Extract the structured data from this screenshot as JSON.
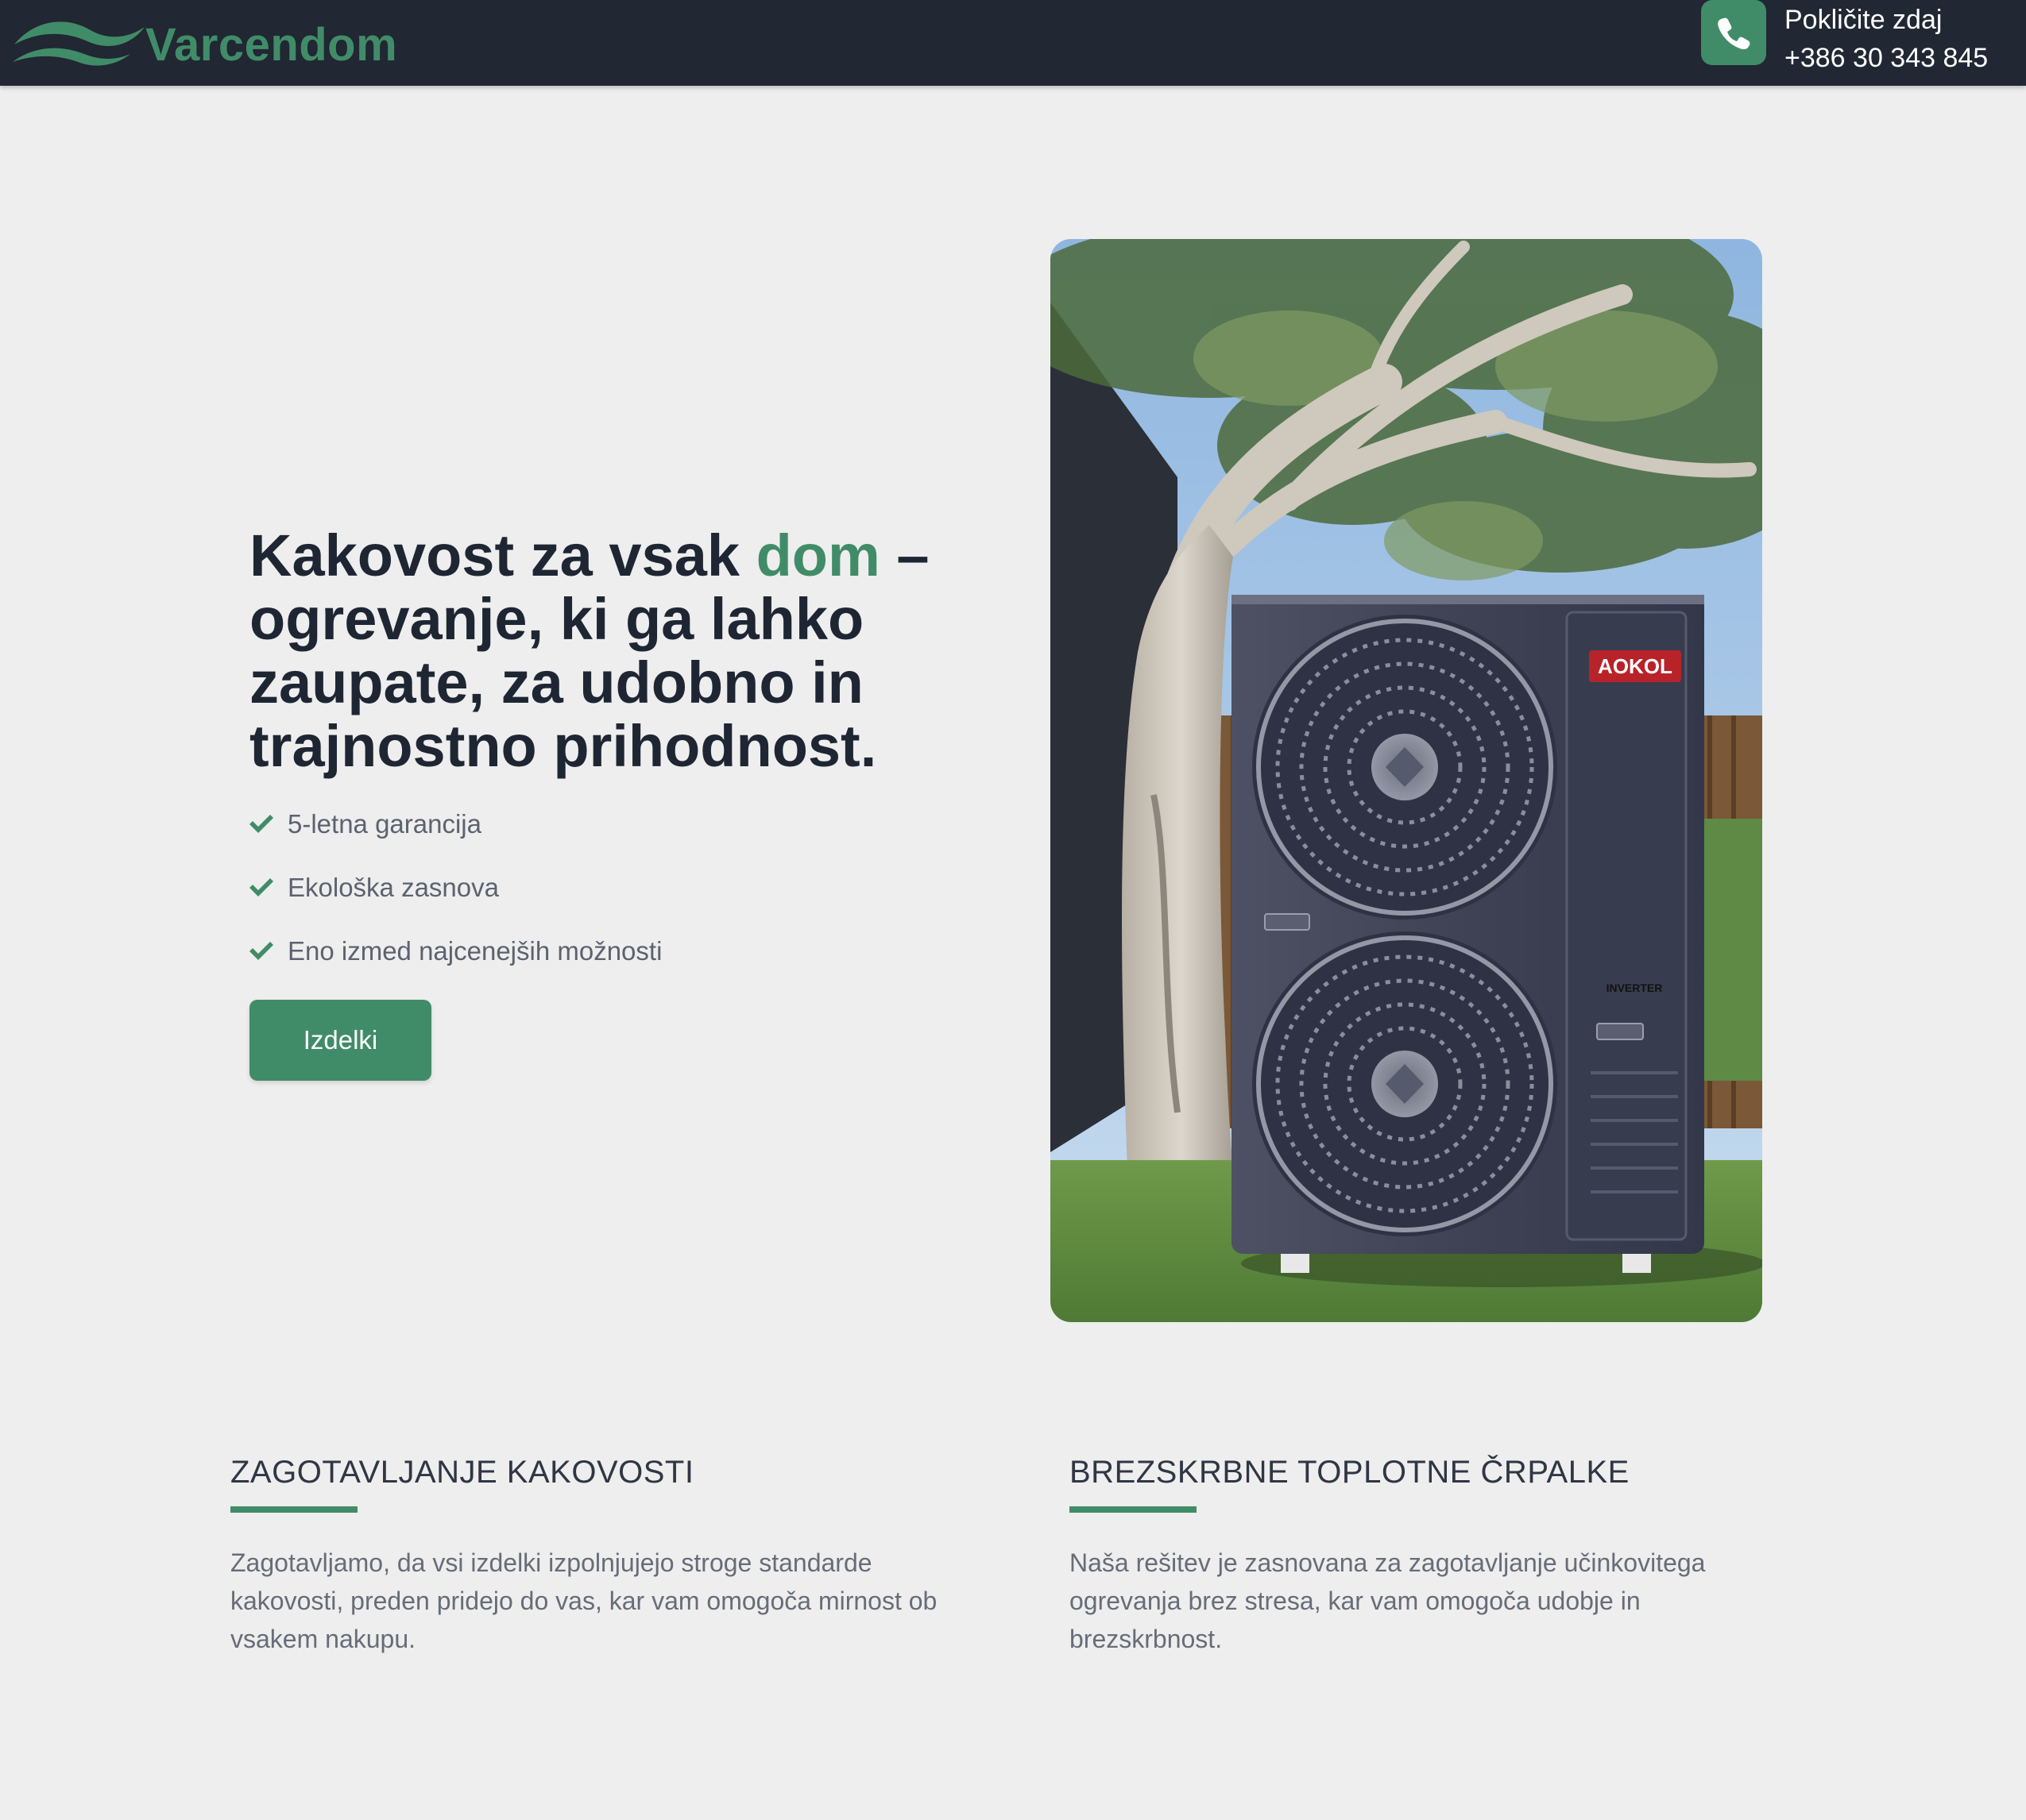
{
  "header": {
    "brand": "Varcendom",
    "call_label": "Pokličite zdaj",
    "call_number": "+386 30 343 845",
    "accent_color": "#418c68",
    "background_color": "#212733",
    "phone_icon": "phone-icon"
  },
  "hero": {
    "title_before": "Kakovost za vsak ",
    "title_accent": "dom",
    "title_after": " – ogrevanje, ki ga lahko zaupate, za udobno in trajnostno prihodnost.",
    "features": [
      {
        "text": "5-letna garancija",
        "icon": "check-icon"
      },
      {
        "text": "Ekološka zasnova",
        "icon": "check-icon"
      },
      {
        "text": "Eno izmed najcenejših možnosti",
        "icon": "check-icon"
      }
    ],
    "cta_label": "Izdelki",
    "product_brand": "AOKOL",
    "product_badge": "INVERTER"
  },
  "info": [
    {
      "title": "ZAGOTAVLJANJE KAKOVOSTI",
      "text": "Zagotavljamo, da vsi izdelki izpolnjujejo stroge standarde kakovosti, preden pridejo do vas, kar vam omogoča mirnost ob vsakem nakupu."
    },
    {
      "title": "BREZSKRBNE TOPLOTNE ČRPALKE",
      "text": "Naša rešitev je zasnovana za zagotavljanje učinkovitega ogrevanja brez stresa, kar vam omogoča udobje in brezskrbnost."
    }
  ]
}
